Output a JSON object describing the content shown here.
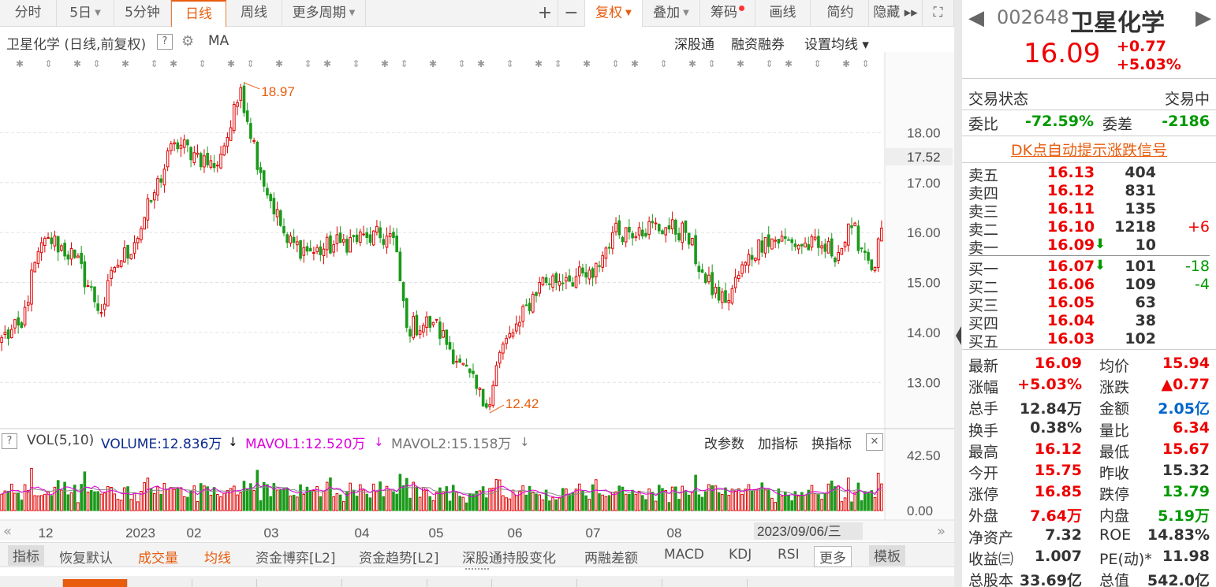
{
  "toolbar": {
    "items": [
      {
        "label": "分时",
        "caret": false
      },
      {
        "label": "5日",
        "caret": true
      },
      {
        "label": "5分钟",
        "caret": false
      },
      {
        "label": "日线",
        "caret": false,
        "active": true
      },
      {
        "label": "周线",
        "caret": false
      },
      {
        "label": "更多周期",
        "caret": true
      }
    ],
    "right_items": [
      {
        "label": "+"
      },
      {
        "label": "−"
      },
      {
        "label": "复权",
        "caret": true
      },
      {
        "label": "叠加",
        "caret": true
      },
      {
        "label": "筹码",
        "dot": true
      },
      {
        "label": "画线"
      },
      {
        "label": "简约"
      },
      {
        "label": "隐藏 ▸▸"
      },
      {
        "label": "⛶"
      }
    ]
  },
  "chart_header": {
    "title": "卫星化学 (日线,前复权)",
    "help": "?",
    "indicator": "MA",
    "right_links": [
      "深股通",
      "融资融券",
      "设置均线 ▾"
    ]
  },
  "volume_header": {
    "help": "?",
    "vol": "VOL(5,10)",
    "volume": "VOLUME:12.836万",
    "mavol1": "MAVOL1:12.520万",
    "mavol2": "MAVOL2:15.158万",
    "actions": [
      "改参数",
      "加指标",
      "换指标"
    ],
    "close": "✕"
  },
  "colors": {
    "up": "#e00000",
    "down": "#1a9a1a",
    "accent": "#e85c0d",
    "mavol1": "#dd00dd",
    "mavol2": "#888888"
  },
  "chart_data": {
    "type": "candlestick",
    "y_ticks": [
      "18.00",
      "17.00",
      "16.00",
      "15.00",
      "14.00",
      "13.00"
    ],
    "ylim": [
      12.2,
      19.3
    ],
    "current_price_label": "17.52",
    "high_label": "18.97",
    "low_label": "12.42",
    "x_labels": [
      "12",
      "2023",
      "02",
      "03",
      "04",
      "05",
      "06",
      "07",
      "08"
    ],
    "date_label": "2023/09/06/三",
    "volume_ticks": [
      "42.50",
      "0.00"
    ],
    "anchors": [
      {
        "i": 0,
        "p": 13.9
      },
      {
        "i": 6,
        "p": 14.1
      },
      {
        "i": 10,
        "p": 15.4
      },
      {
        "i": 14,
        "p": 15.9
      },
      {
        "i": 22,
        "p": 15.5
      },
      {
        "i": 30,
        "p": 14.4
      },
      {
        "i": 34,
        "p": 15.3
      },
      {
        "i": 40,
        "p": 15.8
      },
      {
        "i": 46,
        "p": 16.8
      },
      {
        "i": 52,
        "p": 17.8
      },
      {
        "i": 58,
        "p": 17.6
      },
      {
        "i": 64,
        "p": 17.3
      },
      {
        "i": 69,
        "p": 18.1
      },
      {
        "i": 72,
        "p": 18.9
      },
      {
        "i": 78,
        "p": 17.2
      },
      {
        "i": 86,
        "p": 15.8
      },
      {
        "i": 94,
        "p": 15.6
      },
      {
        "i": 102,
        "p": 15.8
      },
      {
        "i": 110,
        "p": 15.9
      },
      {
        "i": 118,
        "p": 15.9
      },
      {
        "i": 122,
        "p": 14.1
      },
      {
        "i": 130,
        "p": 14.2
      },
      {
        "i": 138,
        "p": 13.4
      },
      {
        "i": 146,
        "p": 12.5
      },
      {
        "i": 150,
        "p": 13.6
      },
      {
        "i": 156,
        "p": 14.2
      },
      {
        "i": 162,
        "p": 15.0
      },
      {
        "i": 170,
        "p": 15.1
      },
      {
        "i": 178,
        "p": 15.1
      },
      {
        "i": 184,
        "p": 16.0
      },
      {
        "i": 192,
        "p": 16.1
      },
      {
        "i": 200,
        "p": 16.1
      },
      {
        "i": 206,
        "p": 16.0
      },
      {
        "i": 212,
        "p": 15.0
      },
      {
        "i": 218,
        "p": 14.6
      },
      {
        "i": 224,
        "p": 15.4
      },
      {
        "i": 230,
        "p": 15.9
      },
      {
        "i": 238,
        "p": 15.8
      },
      {
        "i": 246,
        "p": 15.7
      },
      {
        "i": 252,
        "p": 15.6
      },
      {
        "i": 256,
        "p": 16.1
      },
      {
        "i": 260,
        "p": 15.6
      },
      {
        "i": 263,
        "p": 15.3
      },
      {
        "i": 265,
        "p": 16.09
      }
    ],
    "candle_count": 266
  },
  "bottom_tabs": [
    {
      "label": "指标",
      "style": "sel"
    },
    {
      "label": "恢复默认",
      "style": ""
    },
    {
      "label": "成交量",
      "style": "red"
    },
    {
      "label": "均线",
      "style": "red"
    },
    {
      "label": "资金博弈[L2]",
      "style": ""
    },
    {
      "label": "资金趋势[L2]",
      "style": ""
    },
    {
      "label": "深股通持股变化",
      "style": ""
    },
    {
      "label": "两融差额",
      "style": ""
    },
    {
      "label": "MACD",
      "style": ""
    },
    {
      "label": "KDJ",
      "style": ""
    },
    {
      "label": "RSI",
      "style": ""
    },
    {
      "label": "更多",
      "style": "box"
    },
    {
      "label": "模板",
      "style": "sel"
    }
  ],
  "panel": {
    "code": "002648",
    "name": "卫星化学",
    "price": "16.09",
    "change": "+0.77",
    "change_pct": "+5.03%",
    "status_label": "交易状态",
    "status_value": "交易中",
    "weibi_label": "委比",
    "weibi_value": "-72.59%",
    "weicha_label": "委差",
    "weicha_value": "-2186",
    "dk_link": "DK点自动提示涨跌信号",
    "sells": [
      {
        "label": "卖五",
        "price": "16.13",
        "vol": "404",
        "delta": ""
      },
      {
        "label": "卖四",
        "price": "16.12",
        "vol": "831",
        "delta": ""
      },
      {
        "label": "卖三",
        "price": "16.11",
        "vol": "135",
        "delta": ""
      },
      {
        "label": "卖二",
        "price": "16.10",
        "vol": "1218",
        "delta": "+6"
      },
      {
        "label": "卖一",
        "price": "16.09",
        "vol": "10",
        "delta": "",
        "arrow": "⬇"
      }
    ],
    "buys": [
      {
        "label": "买一",
        "price": "16.07",
        "vol": "101",
        "delta": "-18",
        "arrow": "⬇"
      },
      {
        "label": "买二",
        "price": "16.06",
        "vol": "109",
        "delta": "-4"
      },
      {
        "label": "买三",
        "price": "16.05",
        "vol": "63",
        "delta": ""
      },
      {
        "label": "买四",
        "price": "16.04",
        "vol": "38",
        "delta": ""
      },
      {
        "label": "买五",
        "price": "16.03",
        "vol": "102",
        "delta": ""
      }
    ],
    "stats": [
      {
        "l1": "最新",
        "v1": "16.09",
        "c1": "red",
        "l2": "均价",
        "v2": "15.94",
        "c2": "red"
      },
      {
        "l1": "涨幅",
        "v1": "+5.03%",
        "c1": "red",
        "l2": "涨跌",
        "v2": "▲0.77",
        "c2": "red"
      },
      {
        "l1": "总手",
        "v1": "12.84万",
        "c1": "",
        "l2": "金额",
        "v2": "2.05亿",
        "c2": "blue"
      },
      {
        "l1": "换手",
        "v1": "0.38%",
        "c1": "",
        "l2": "量比",
        "v2": "6.34",
        "c2": "red"
      },
      {
        "l1": "最高",
        "v1": "16.12",
        "c1": "red",
        "l2": "最低",
        "v2": "15.67",
        "c2": "red"
      },
      {
        "l1": "今开",
        "v1": "15.75",
        "c1": "red",
        "l2": "昨收",
        "v2": "15.32",
        "c2": ""
      },
      {
        "l1": "涨停",
        "v1": "16.85",
        "c1": "red",
        "l2": "跌停",
        "v2": "13.79",
        "c2": "green"
      },
      {
        "l1": "外盘",
        "v1": "7.64万",
        "c1": "red",
        "l2": "内盘",
        "v2": "5.19万",
        "c2": "green"
      },
      {
        "l1": "净资产",
        "v1": "7.32",
        "c1": "",
        "l2": "ROE",
        "v2": "14.83%",
        "c2": ""
      },
      {
        "l1": "收益㈢",
        "v1": "1.007",
        "c1": "",
        "l2": "PE(动)*",
        "v2": "11.98",
        "c2": ""
      },
      {
        "l1": "总股本",
        "v1": "33.69亿",
        "c1": "",
        "l2": "总值",
        "v2": "542.0亿",
        "c2": ""
      }
    ]
  }
}
